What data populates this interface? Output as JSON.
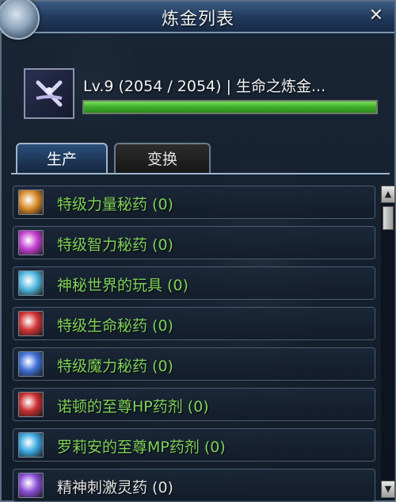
{
  "window": {
    "title": "炼金列表",
    "close_glyph": "✕"
  },
  "profession": {
    "level_text": "Lv.9 (2054 / 2054) | 生命之炼金...",
    "exp_fraction": 1.0,
    "icon": "alchemy-sigil-icon"
  },
  "tabs": [
    {
      "label": "生产",
      "active": true
    },
    {
      "label": "变换",
      "active": false
    }
  ],
  "recipes": [
    {
      "label": "特级力量秘药 (0)",
      "icon": "strength-potion-icon",
      "color": "#d98a2a"
    },
    {
      "label": "特级智力秘药 (0)",
      "icon": "intelligence-potion-icon",
      "color": "#c43fd0"
    },
    {
      "label": "神秘世界的玩具 (0)",
      "icon": "mystic-toy-icon",
      "color": "#4fb8e0"
    },
    {
      "label": "特级生命秘药 (0)",
      "icon": "life-potion-icon",
      "color": "#d23434"
    },
    {
      "label": "特级魔力秘药 (0)",
      "icon": "mana-potion-icon",
      "color": "#3f6fd6"
    },
    {
      "label": "诺顿的至尊HP药剂 (0)",
      "icon": "hp-potion-icon",
      "color": "#cc2f2f"
    },
    {
      "label": "罗莉安的至尊MP药剂 (0)",
      "icon": "mp-potion-icon",
      "color": "#3aa9e0"
    },
    {
      "label": "精神刺激灵药 (0)",
      "icon": "spirit-elixir-icon",
      "color": "#8a4fd6"
    }
  ],
  "scrollbar": {
    "up_glyph": "▲",
    "down_glyph": "▼"
  }
}
